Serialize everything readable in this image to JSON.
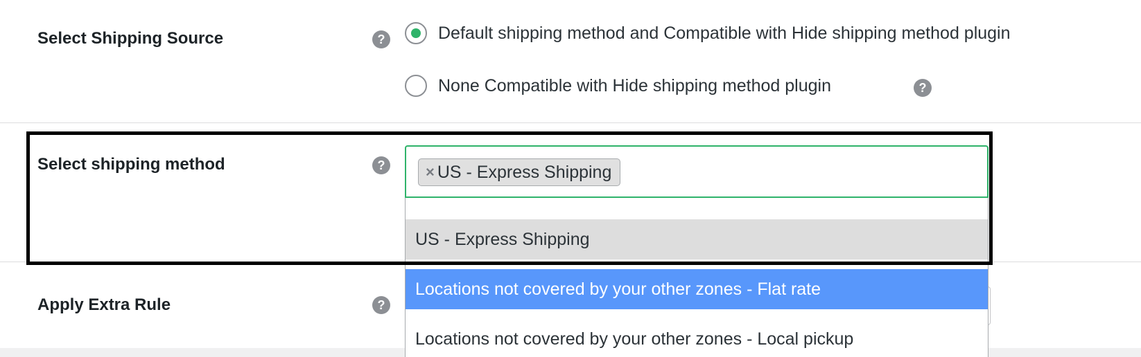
{
  "settings": {
    "shipping_source": {
      "label": "Select Shipping Source",
      "help_icon": "question-icon",
      "options": [
        {
          "label": "Default shipping method and Compatible with Hide shipping method plugin",
          "checked": true
        },
        {
          "label": "None Compatible with Hide shipping method plugin",
          "checked": false
        }
      ],
      "option_help_icon": "question-icon"
    },
    "shipping_method": {
      "label": "Select shipping method",
      "help_icon": "question-icon",
      "selected_chip": {
        "remove_glyph": "×",
        "label": "US - Express Shipping"
      },
      "dropdown": {
        "partial_top_item": "",
        "items": [
          {
            "label": "US - Express Shipping",
            "state": "selected"
          },
          {
            "label": "Locations not covered by your other zones - Flat rate",
            "state": "highlighted"
          },
          {
            "label": "Locations not covered by your other zones - Local pickup",
            "state": "normal"
          }
        ]
      }
    },
    "extra_rule": {
      "label": "Apply Extra Rule",
      "help_icon": "question-icon"
    }
  },
  "help_glyph": "?",
  "colors": {
    "accent_green": "#2fb36a",
    "highlight_blue": "#5897fb",
    "selected_grey": "#dddddd"
  }
}
